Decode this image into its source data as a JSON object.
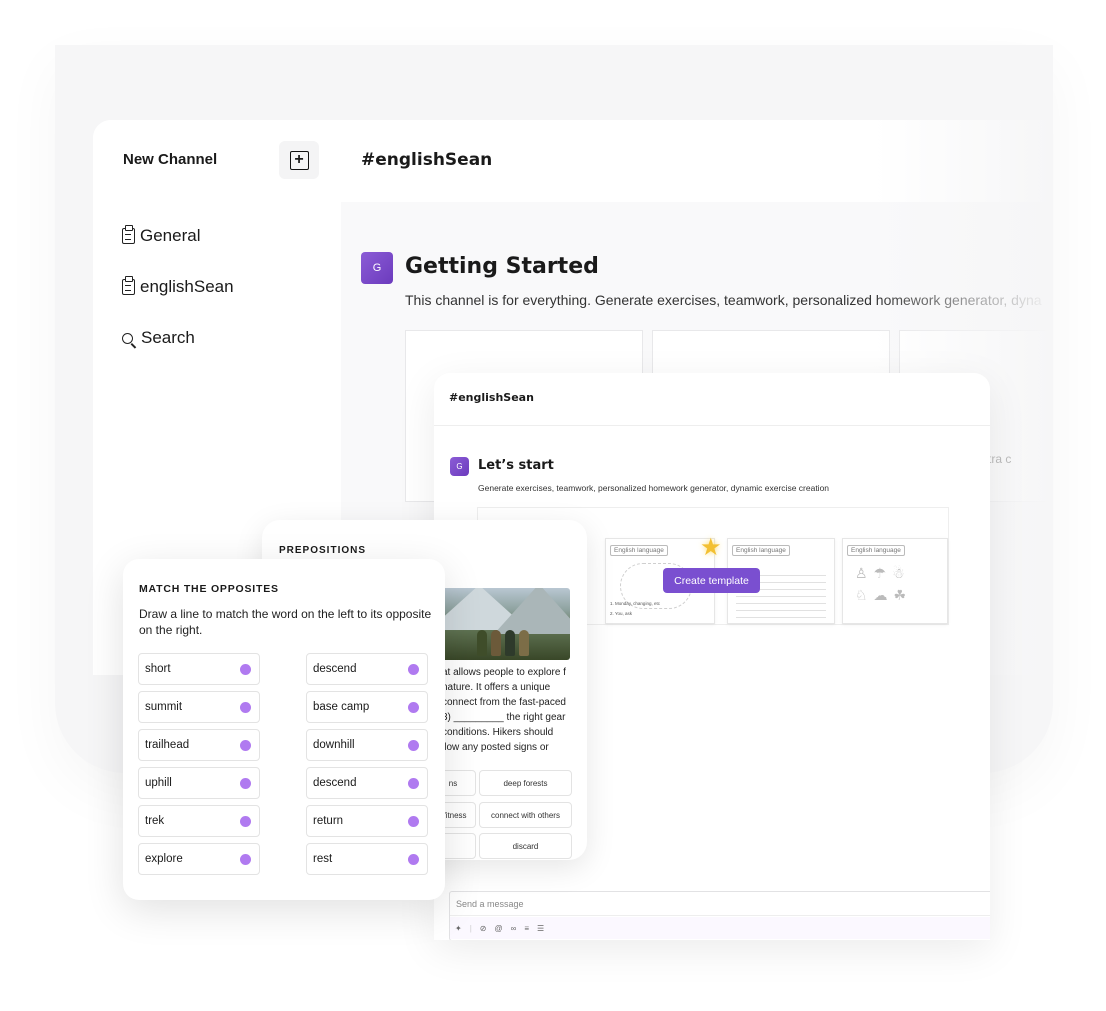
{
  "sidebar": {
    "new_channel_label": "New Channel",
    "items": [
      {
        "label": "General",
        "icon": "clipboard-icon"
      },
      {
        "label": "englishSean",
        "icon": "clipboard-icon"
      },
      {
        "label": "Search",
        "icon": "search-icon"
      }
    ]
  },
  "main": {
    "channel_title": "#englishSean",
    "badge_letter": "G",
    "heading": "Getting Started",
    "description": "This channel is for everything. Generate exercises, teamwork, personalized homework generator, dyna",
    "faded_text": "tra c"
  },
  "window2": {
    "channel_title": "#englishSean",
    "badge_letter": "G",
    "heading": "Let’s start",
    "description": "Generate exercises, teamwork, personalized homework generator, dynamic exercise creation",
    "template_tags": [
      "English language",
      "English language",
      "English language"
    ],
    "template_item_lines": [
      "1. Monday, changing, etc",
      "2. You, ask"
    ],
    "create_template_label": "Create template",
    "message_placeholder": "Send a message",
    "toolbar_icons": [
      "sparkle-icon",
      "attach-icon",
      "mention-icon",
      "link-icon",
      "ordered-list-icon",
      "bullet-list-icon"
    ]
  },
  "prepositions": {
    "title": "PREPOSITIONS",
    "passage": "at allows people to explore f nature. It offers a unique connect from the fast-paced 3) _________ the right gear conditions. Hikers should llow any posted signs or",
    "options": [
      [
        "ns",
        "deep forests"
      ],
      [
        "l fitness",
        "connect with others"
      ],
      [
        "",
        "discard"
      ]
    ]
  },
  "match": {
    "title": "MATCH THE OPPOSITES",
    "instructions": "Draw a line to match the word on the left to its opposite on the right.",
    "left": [
      "short",
      "summit",
      "trailhead",
      "uphill",
      "trek",
      "explore"
    ],
    "right": [
      "descend",
      "base camp",
      "downhill",
      "descend",
      "return",
      "rest"
    ],
    "dot_color": "#b07af0"
  },
  "colors": {
    "accent": "#7a4fd0",
    "badge": "#7442c8"
  }
}
